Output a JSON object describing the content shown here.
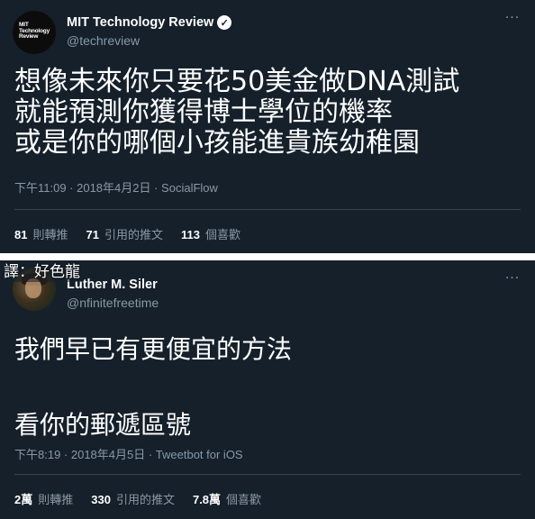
{
  "tweets": [
    {
      "author": {
        "name": "MIT Technology Review",
        "handle": "@techreview",
        "verified": true,
        "avatar_logo_lines": [
          "MIT",
          "Technology",
          "Review"
        ]
      },
      "more_icon": "more-horizontal-icon",
      "text": "想像未來你只要花50美金做DNA測試\n就能預測你獲得博士學位的機率\n或是你的哪個小孩能進貴族幼稚園",
      "meta": "下午11:09 · 2018年4月2日 · SocialFlow",
      "stats": [
        {
          "count": "81",
          "label": "則轉推"
        },
        {
          "count": "71",
          "label": "引用的推文"
        },
        {
          "count": "113",
          "label": "個喜歡"
        }
      ]
    },
    {
      "author": {
        "name": "Luther M. Siler",
        "handle": "@nfinitefreetime",
        "verified": false
      },
      "translator_label": "譯：好色龍",
      "more_icon": "more-horizontal-icon",
      "text": "我們早已有更便宜的方法\n\n看你的郵遞區號",
      "meta": "下午8:19 · 2018年4月5日 · Tweetbot for iOS",
      "stats": [
        {
          "count": "2萬",
          "label": "則轉推"
        },
        {
          "count": "330",
          "label": "引用的推文"
        },
        {
          "count": "7.8萬",
          "label": "個喜歡"
        }
      ]
    }
  ],
  "colors": {
    "background": "#15202b",
    "text_primary": "#ffffff",
    "text_secondary": "#8899a6",
    "border": "#38444d"
  }
}
